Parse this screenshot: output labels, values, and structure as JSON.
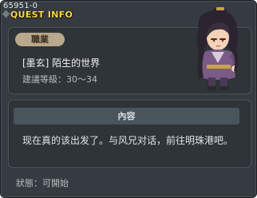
{
  "window": {
    "quest_id": "65951-0",
    "title": "QUEST INFO"
  },
  "job": {
    "badge_label": "職業",
    "name": "[墨玄] 陌生的世界",
    "level_range": "建議等級：30～34"
  },
  "content": {
    "header": "內容",
    "text": "现在真的该出发了。与风兄对话，前往明珠港吧。"
  },
  "status": {
    "text": "狀態：可開始"
  },
  "colors": {
    "title": "#ffd84a",
    "window_bg": "#353b40",
    "badge_bg": "#b9a88c"
  },
  "npc": {
    "icon": "npc-character-portrait"
  }
}
